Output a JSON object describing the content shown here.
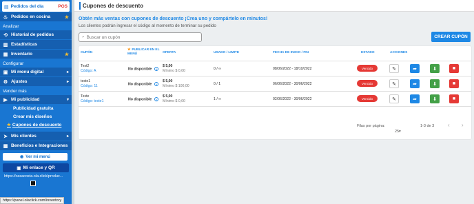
{
  "sidebar": {
    "top_label": "Pedidos del día",
    "top_badge": "POS",
    "kitchen": "Pedidos en cocina",
    "analyze_section": "Analizar",
    "history": "Historial de pedidos",
    "stats": "Estadísticas",
    "inventory": "Inventario",
    "configure_section": "Configurar",
    "digital_menu": "Mi menu digital",
    "settings": "Ajustes",
    "sell_section": "Vender más",
    "advertising": "Mi publicidad",
    "free_ads": "Publicidad gratuita",
    "create_designs": "Crear mis diseños",
    "coupons": "Cupones de descuento",
    "customers": "Mis clientes",
    "benefits": "Beneficios e Integraciones",
    "view_menu": "Ver mi menú",
    "link_qr": "Mi enlace y QR",
    "link_url": "https://casacosta.ola.click/produc..."
  },
  "status_url": "https://panel.olaclick.com/inventory",
  "header": {
    "title": "Cupones de descuento"
  },
  "main": {
    "promo": "Obtén más ventas con cupones de descuento ¡Crea uno y compártelo en minutos!",
    "subtitle": "Los clientes podrán ingresar el código al momento de terminar su pedido",
    "search_placeholder": "Buscar un cupón",
    "create_button": "CREAR CUPÓN"
  },
  "table": {
    "headers": {
      "coupon": "CUPÓN",
      "publish": "PUBLICAR EN EL MENÚ",
      "offer": "OFERTA",
      "used": "USADO / LIMITE",
      "dates": "FECHA DE INICIO / FIN",
      "status": "ESTADO",
      "actions": "ACCIONES"
    },
    "rows": [
      {
        "name": "Test2",
        "code": "Código: A",
        "publish": "No disponible",
        "offer": "$ 5,00",
        "minimum": "Mínimo $ 0,00",
        "used": "0 / ∞",
        "dates": "08/06/2022 - 18/10/2022",
        "status": "Vencido"
      },
      {
        "name": "teste1",
        "code": "Código: 11",
        "publish": "No disponible",
        "offer": "$ 5,00",
        "minimum": "Mínimo $ 100,00",
        "used": "0 / 1",
        "dates": "06/06/2022 - 30/06/2022",
        "status": "Vencido"
      },
      {
        "name": "Teste",
        "code": "Código: teste1",
        "publish": "No disponible",
        "offer": "$ 5,00",
        "minimum": "Mínimo $ 0,00",
        "used": "1 / ∞",
        "dates": "02/06/2022 - 30/06/2022",
        "status": "Vencido"
      }
    ],
    "footer": {
      "rows_per_page_label": "Filas por página:",
      "rows_per_page_value": "25",
      "range": "1-3 de 3"
    }
  },
  "icons": {
    "star": "★",
    "chevron_down": "▾",
    "chevron_right": "▸",
    "prev": "‹",
    "next": "›"
  }
}
